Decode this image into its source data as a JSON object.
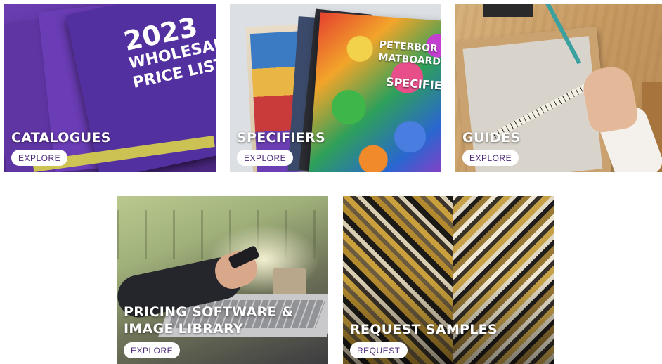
{
  "tiles": [
    {
      "id": "catalogues",
      "title": "CATALOGUES",
      "button_label": "EXPLORE",
      "image_text": {
        "line1": "2023",
        "line2": "WHOLESALE",
        "line3": "PRICE LIST"
      }
    },
    {
      "id": "specifiers",
      "title": "SPECIFIERS",
      "button_label": "EXPLORE",
      "image_text": {
        "brand1": "PETERBOR",
        "brand2": "MATBOARD",
        "label": "SPECIFIER"
      }
    },
    {
      "id": "guides",
      "title": "GUIDES",
      "button_label": "EXPLORE"
    },
    {
      "id": "pricing-software",
      "title": "PRICING SOFTWARE & IMAGE LIBRARY",
      "title_line1": "PRICING SOFTWARE &",
      "title_line2": "IMAGE LIBRARY",
      "button_label": "EXPLORE"
    },
    {
      "id": "request-samples",
      "title": "REQUEST SAMPLES",
      "button_label": "REQUEST"
    }
  ],
  "colors": {
    "button_text": "#4d2a7a",
    "button_bg": "#ffffff",
    "title_text": "#ffffff"
  }
}
